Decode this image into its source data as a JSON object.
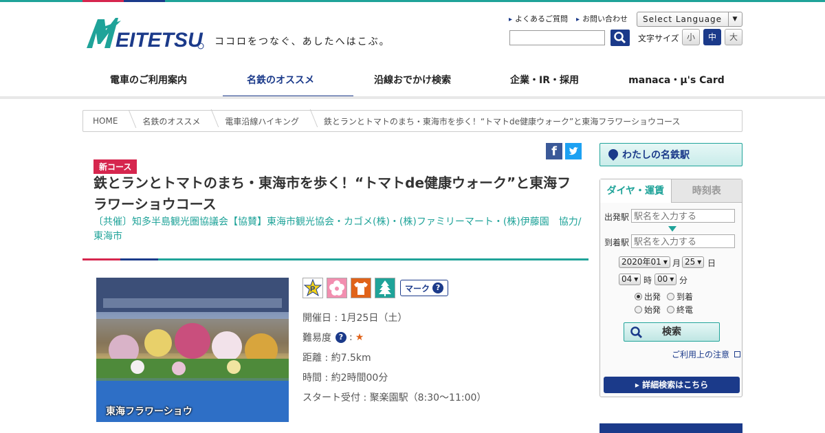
{
  "brand": {
    "logo_text": "MEITETSU",
    "tagline": "ココロをつなぐ、あしたへはこぶ。",
    "colors": {
      "teal": "#1fa399",
      "navy": "#1b3a8a",
      "red": "#d6264e"
    }
  },
  "header": {
    "links": [
      "よくあるご質問",
      "お問い合わせ"
    ],
    "language_select": "Select Language",
    "font_size_label": "文字サイズ",
    "font_sizes": [
      "小",
      "中",
      "大"
    ],
    "font_size_active": "中"
  },
  "nav": {
    "items": [
      "電車のご利用案内",
      "名鉄のオススメ",
      "沿線おでかけ検索",
      "企業・IR・採用",
      "manaca・µ's Card"
    ],
    "active": "名鉄のオススメ"
  },
  "breadcrumb": [
    "HOME",
    "名鉄のオススメ",
    "電車沿線ハイキング",
    "鉄とランとトマトのまち・東海市を歩く！“トマトde健康ウォーク”と東海フラワーショウコース"
  ],
  "article": {
    "badge": "新コース",
    "title": "鉄とランとトマトのまち・東海市を歩く！“トマトde健康ウォーク”と東海フラワーショウコース",
    "sponsor": "〔共催〕知多半島観光圏協議会【協賛】東海市観光協会・カゴメ(株)・(株)ファミリーマート・(株)伊藤園　協力/東海市",
    "photo_caption": "東海フラワーショウ",
    "mark_button": "マーク",
    "info": {
      "date": "開催日 : 1月25日（土）",
      "difficulty_label": "難易度",
      "difficulty_sep": ":",
      "difficulty_stars": "★",
      "distance": "距離 : 約7.5km",
      "time": "時間 : 約2時間00分",
      "start": "スタート受付 : 聚楽園駅（8:30～11:00）"
    },
    "icons": [
      "parking-icon",
      "flower-icon",
      "souvenir-shirt-icon",
      "tree-icon"
    ]
  },
  "sidebar": {
    "my_station": "わたしの名鉄駅",
    "tabs": [
      "ダイヤ・運賃",
      "時刻表"
    ],
    "from_label": "出発駅",
    "to_label": "到着駅",
    "station_placeholder": "駅名を入力する",
    "year_month": "2020年01",
    "month_unit": "月",
    "day": "25",
    "day_unit": "日",
    "hour": "04",
    "hour_unit": "時",
    "minute": "00",
    "minute_unit": "分",
    "radios": [
      "出発",
      "到着",
      "始発",
      "終電"
    ],
    "radio_selected": "出発",
    "search_button": "検索",
    "notice_link": "ご利用上の注意",
    "detail_button": "詳細検索はこちら"
  }
}
